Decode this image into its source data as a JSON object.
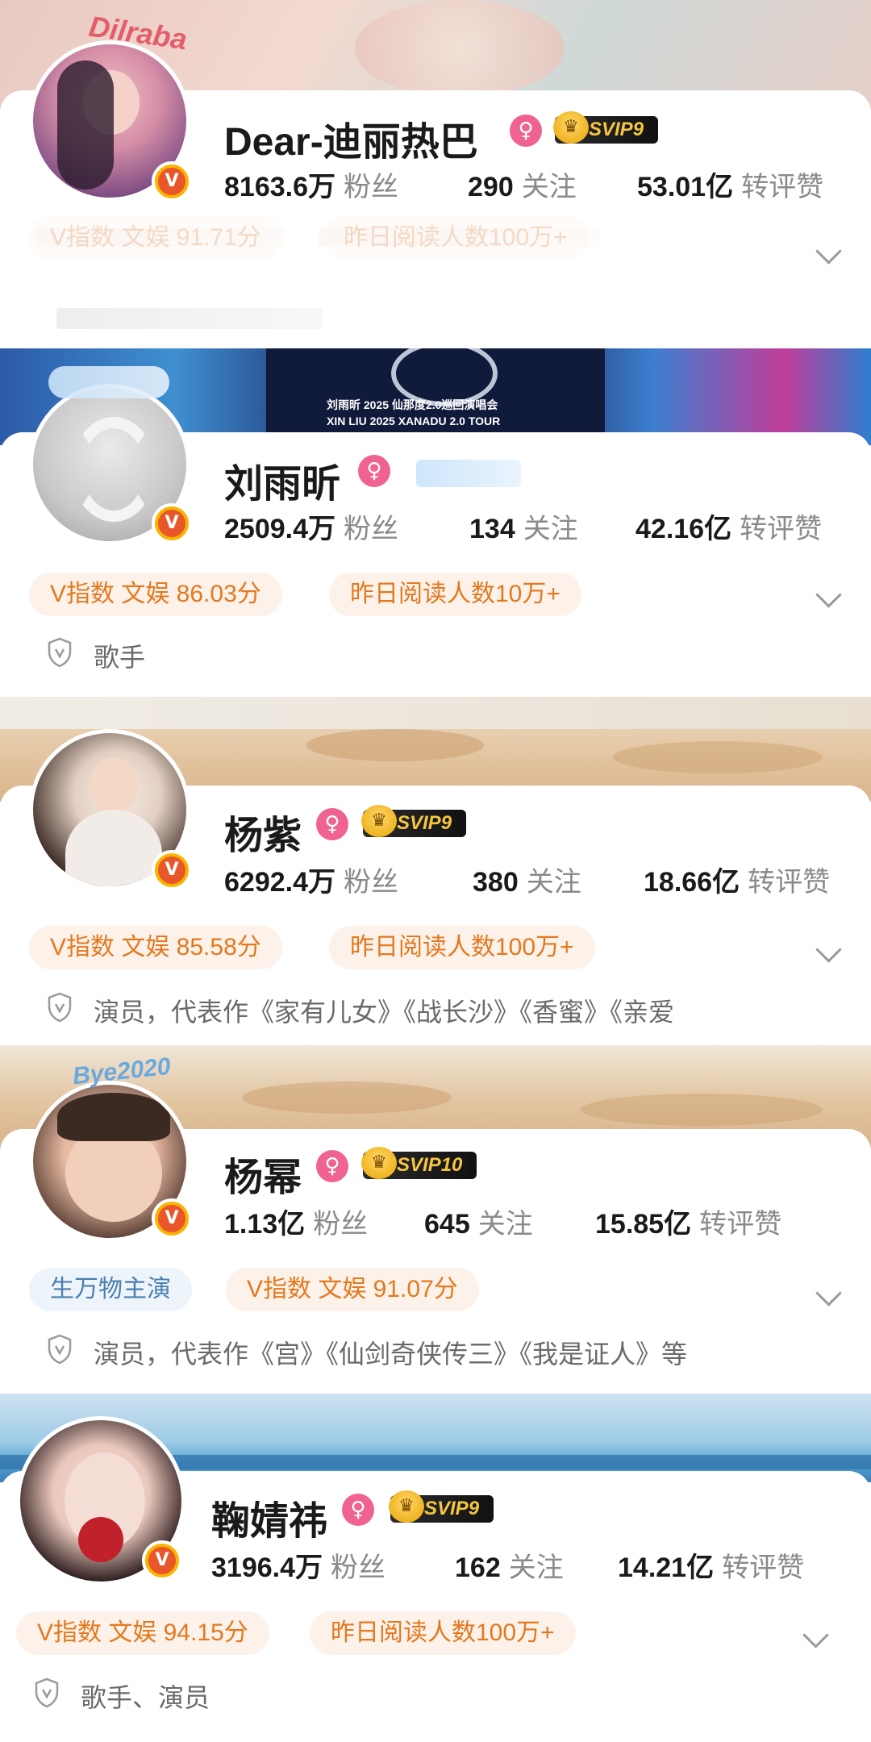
{
  "profiles": [
    {
      "name": "Dear-迪丽热巴",
      "gender_symbol": "♀",
      "svip": "SVIP9",
      "stats": {
        "followers_value": "8163.6万",
        "followers_label": "粉丝",
        "following_value": "290",
        "following_label": "关注",
        "likes_value": "53.01亿",
        "likes_label": "转评赞"
      },
      "tags": [
        "V指数 文娱 91.71分",
        "昨日阅读人数100万+"
      ],
      "avatar_caption": "Dilraba"
    },
    {
      "name": "刘雨昕",
      "gender_symbol": "♀",
      "stats": {
        "followers_value": "2509.4万",
        "followers_label": "粉丝",
        "following_value": "134",
        "following_label": "关注",
        "likes_value": "42.16亿",
        "likes_label": "转评赞"
      },
      "tags": [
        "V指数 文娱 86.03分",
        "昨日阅读人数10万+"
      ],
      "description": "歌手",
      "banner_text_1": "刘雨昕 2025 仙那度2.0巡回演唱会",
      "banner_text_2": "XIN LIU  2025  XANADU 2.0  TOUR"
    },
    {
      "name": "杨紫",
      "gender_symbol": "♀",
      "svip": "SVIP9",
      "stats": {
        "followers_value": "6292.4万",
        "followers_label": "粉丝",
        "following_value": "380",
        "following_label": "关注",
        "likes_value": "18.66亿",
        "likes_label": "转评赞"
      },
      "tags": [
        "V指数 文娱 85.58分",
        "昨日阅读人数100万+"
      ],
      "description": "演员，代表作《家有儿女》《战长沙》《香蜜》《亲爱"
    },
    {
      "name": "杨幂",
      "gender_symbol": "♀",
      "svip": "SVIP10",
      "stats": {
        "followers_value": "1.13亿",
        "followers_label": "粉丝",
        "following_value": "645",
        "following_label": "关注",
        "likes_value": "15.85亿",
        "likes_label": "转评赞"
      },
      "tags": [
        "生万物主演",
        "V指数 文娱 91.07分"
      ],
      "description": "演员，代表作《宫》《仙剑奇侠传三》《我是证人》等",
      "avatar_caption": "Bye2020"
    },
    {
      "name": "鞠婧祎",
      "gender_symbol": "♀",
      "svip": "SVIP9",
      "stats": {
        "followers_value": "3196.4万",
        "followers_label": "粉丝",
        "following_value": "162",
        "following_label": "关注",
        "likes_value": "14.21亿",
        "likes_label": "转评赞"
      },
      "tags": [
        "V指数 文娱 94.15分",
        "昨日阅读人数100万+"
      ],
      "description": "歌手、演员"
    }
  ],
  "verified_badge": "V",
  "crown_icon": "♛",
  "colors": {
    "tag_orange_bg": "#fdf2ea",
    "tag_orange_text": "#e4781e",
    "tag_blue_bg": "#edf4fa",
    "tag_blue_text": "#4a7fb0",
    "gender_pink": "#f06292",
    "verified_orange": "#e8562a"
  }
}
